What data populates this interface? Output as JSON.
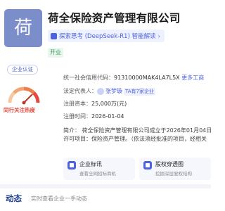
{
  "company": {
    "logo_char": "荷",
    "name": "荷全保险资产管理有限公司",
    "ai_chip": "探索思考 (DeepSeek-R1) 智能解读",
    "industry_tag": "开业"
  },
  "left": {
    "cert_badge": "企业认证",
    "hot_label": "同行关注热度"
  },
  "info": {
    "credit_code_label": "统一社会信用代码：",
    "credit_code_value": "91310000MAK4LA7L5X",
    "copy_label": "更多工商",
    "legal_rep_label": "法定代表人：",
    "legal_rep_name": "张梦璇",
    "legal_rep_tag": "TA有7家企业",
    "capital_label": "注册资本：",
    "capital_value": "25,000万(元)",
    "date_label": "注册时间：",
    "date_value": "2026-01-04",
    "intro_line1": "简介： 荷全保险资产管理有限公司成立于2026年01月04日",
    "intro_line2": "许可项目：保险资产管理。（依法须经批准的项目，经相关"
  },
  "cards": [
    {
      "title": "企业标讯",
      "sub": "查看全网招标商机"
    },
    {
      "title": "股权穿透图",
      "sub": "挖掘深层股权结构"
    }
  ],
  "dynamic": {
    "title": "动态",
    "subtitle": "实时查看企业一手动态"
  },
  "colors": {
    "brand": "#4d62e0",
    "logo_bg": "#7b8ec9",
    "hot": "#e24b3f",
    "green": "#3aa063"
  },
  "hot_level": 0.75
}
